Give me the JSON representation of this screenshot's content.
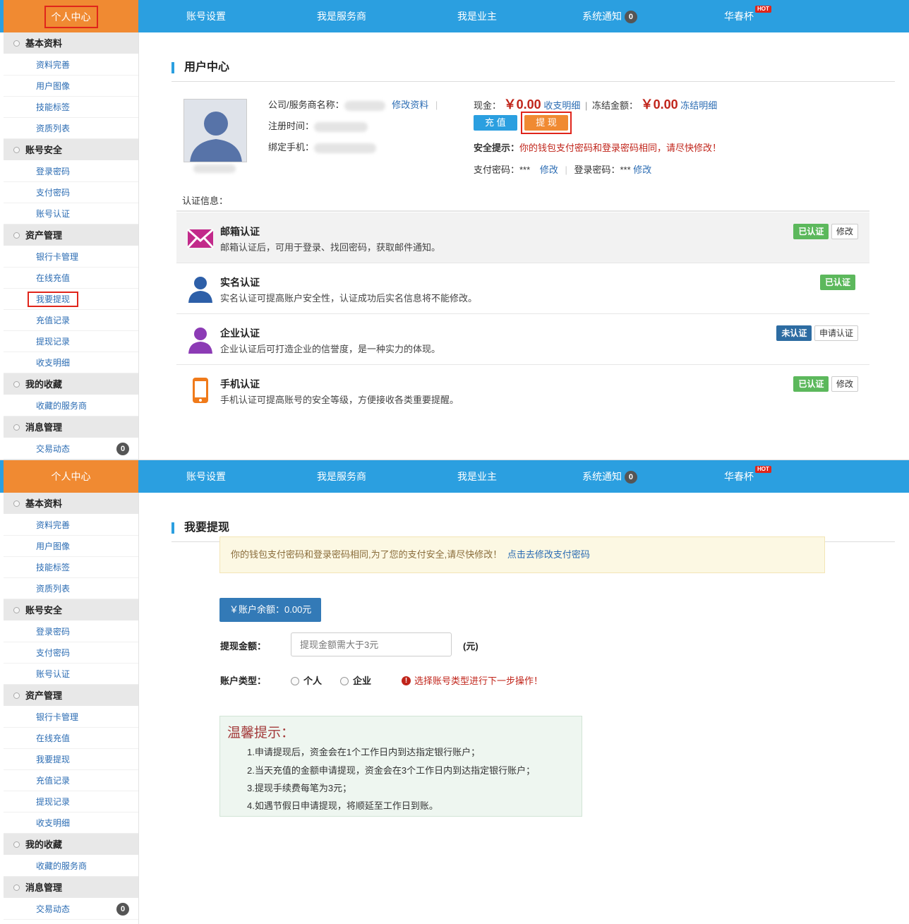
{
  "nav": {
    "home": "个人中心",
    "items": [
      "账号设置",
      "我是服务商",
      "我是业主",
      "系统通知",
      "华春杯"
    ],
    "notify_count": "0",
    "hot": "HOT"
  },
  "sidebar": {
    "groups": [
      {
        "title": "基本资料",
        "items": [
          "资料完善",
          "用户图像",
          "技能标签",
          "资质列表"
        ]
      },
      {
        "title": "账号安全",
        "items": [
          "登录密码",
          "支付密码",
          "账号认证"
        ]
      },
      {
        "title": "资产管理",
        "items": [
          "银行卡管理",
          "在线充值",
          "我要提现",
          "充值记录",
          "提现记录",
          "收支明细"
        ]
      },
      {
        "title": "我的收藏",
        "items": [
          "收藏的服务商"
        ]
      },
      {
        "title": "消息管理",
        "items": [
          "交易动态"
        ]
      }
    ],
    "msg_count": "0"
  },
  "user_center": {
    "title": "用户中心",
    "company_label": "公司/服务商名称：",
    "edit_profile": "修改资料",
    "reg_time_label": "注册时间：",
    "phone_label": "绑定手机：",
    "cash_label": "现金：",
    "cash_value": "￥0.00",
    "income_detail": "收支明细",
    "frozen_label": "冻结金额：",
    "frozen_value": "￥0.00",
    "frozen_detail": "冻结明细",
    "recharge": "充 值",
    "withdraw": "提 现",
    "security_label": "安全提示：",
    "security_text": "你的钱包支付密码和登录密码相同，请尽快修改！",
    "pay_pwd_label": "支付密码：***",
    "login_pwd_label": "登录密码：***",
    "modify": "修改",
    "cert_info": "认证信息：",
    "certs": [
      {
        "title": "邮箱认证",
        "desc": "邮箱认证后，可用于登录、找回密码，获取邮件通知。",
        "status": "已认证",
        "action": "修改"
      },
      {
        "title": "实名认证",
        "desc": "实名认证可提高账户安全性，认证成功后实名信息将不能修改。",
        "status": "已认证",
        "action": ""
      },
      {
        "title": "企业认证",
        "desc": "企业认证后可打造企业的信誉度，是一种实力的体现。",
        "status": "未认证",
        "action": "申请认证"
      },
      {
        "title": "手机认证",
        "desc": "手机认证可提高账号的安全等级，方便接收各类重要提醒。",
        "status": "已认证",
        "action": "修改"
      }
    ]
  },
  "withdraw_page": {
    "title": "我要提现",
    "warning": "你的钱包支付密码和登录密码相同,为了您的支付安全,请尽快修改！",
    "warning_link": "点击去修改支付密码",
    "balance": "￥账户余额：0.00元",
    "amount_label": "提现金额：",
    "amount_placeholder": "提现金额需大于3元",
    "unit": "(元)",
    "type_label": "账户类型：",
    "type_personal": "个人",
    "type_company": "企业",
    "type_hint": "选择账号类型进行下一步操作！",
    "tips_title": "温馨提示：",
    "tips": [
      "1.申请提现后，资金会在1个工作日内到达指定银行账户；",
      "2.当天充值的金额申请提现，资金会在3个工作日内到达指定银行账户；",
      "3.提现手续费每笔为3元；",
      "4.如遇节假日申请提现，将顺延至工作日到账。"
    ]
  }
}
